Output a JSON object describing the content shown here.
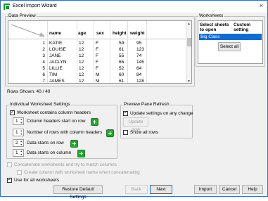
{
  "window": {
    "title": "Excel Import Wizard",
    "close_glyph": "×"
  },
  "data_preview": {
    "label": "Data Preview",
    "columns": [
      "name",
      "age",
      "sex",
      "height",
      "weight"
    ],
    "rows": [
      {
        "n": "1",
        "name": "KATIE",
        "age": "12",
        "sex": "F",
        "height": "59",
        "weight": "95"
      },
      {
        "n": "2",
        "name": "LOUISE",
        "age": "12",
        "sex": "F",
        "height": "61",
        "weight": "123"
      },
      {
        "n": "3",
        "name": "JANE",
        "age": "12",
        "sex": "F",
        "height": "55",
        "weight": "74"
      },
      {
        "n": "4",
        "name": "JACLYN",
        "age": "12",
        "sex": "F",
        "height": "66",
        "weight": "145"
      },
      {
        "n": "5",
        "name": "LILLIE",
        "age": "12",
        "sex": "F",
        "height": "52",
        "weight": "64"
      },
      {
        "n": "6",
        "name": "TIM",
        "age": "12",
        "sex": "M",
        "height": "60",
        "weight": "84"
      },
      {
        "n": "7",
        "name": "JAMES",
        "age": "12",
        "sex": "M",
        "height": "61",
        "weight": "128"
      }
    ],
    "rows_shown": "Rows Shown: 40 / 40"
  },
  "worksheets": {
    "label": "Worksheets",
    "col1_header": "Select sheets to open",
    "col2_header": "Custom setting",
    "items": [
      "Big Class"
    ],
    "select_all": "Select all"
  },
  "settings": {
    "label": "Individual Worksheet Settings",
    "contains_headers": "Worksheet contains column headers",
    "headers_start_row": {
      "value": "1",
      "label": "Column headers start on row"
    },
    "num_header_rows": {
      "value": "1",
      "label": "Number of rows with column headers"
    },
    "data_start_row": {
      "value": "2",
      "label": "Data starts on row"
    },
    "data_start_col": {
      "value": "1",
      "label": "Data starts on column"
    }
  },
  "preview_refresh": {
    "label": "Preview Pane Refresh",
    "update_any_change": "Update settings on any change",
    "update_now": "Update now",
    "show_all_rows": "Show all rows"
  },
  "bottom": {
    "concatenate": "Concatenate worksheets and try to match columns",
    "create_column": "Create column with worksheet name when concatenating",
    "use_for_all": "Use for all worksheets"
  },
  "buttons": {
    "restore": "Restore Default Settings",
    "back": "Back",
    "next": "Next",
    "import": "Import",
    "cancel": "Cancel",
    "help": "Help"
  },
  "colors": {
    "selection": "#0f6bd6",
    "plus_icon": "#2aa436"
  }
}
